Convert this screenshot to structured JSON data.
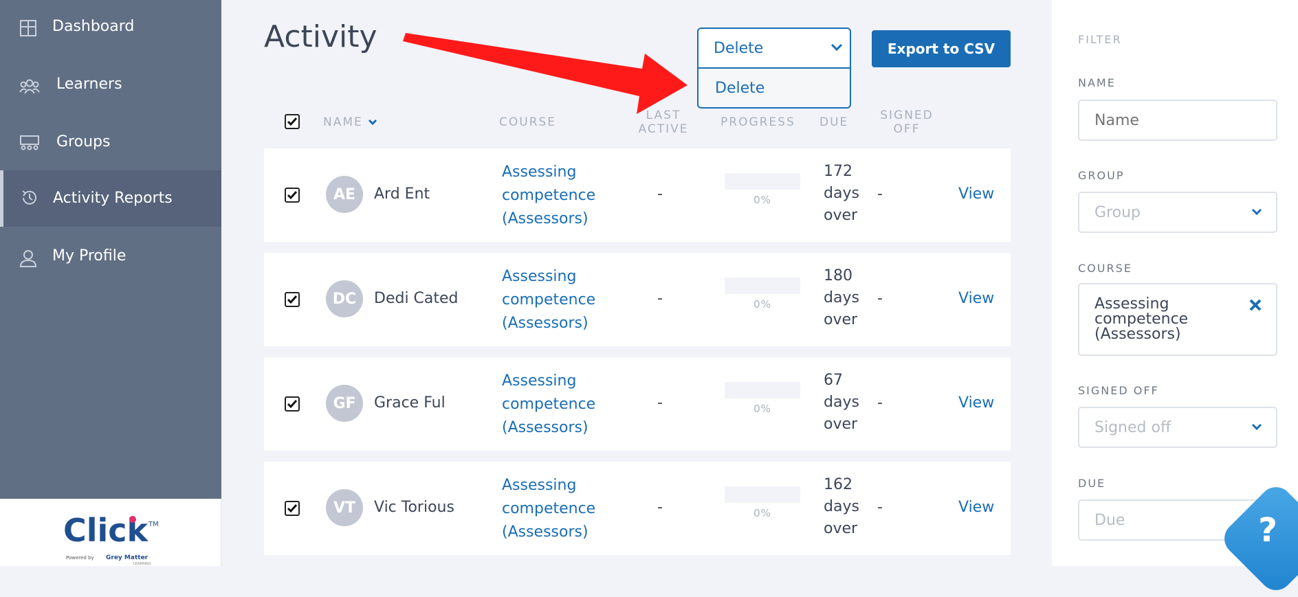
{
  "sidebar": {
    "items": [
      {
        "label": "Dashboard",
        "icon": "grid-icon"
      },
      {
        "label": "Learners",
        "icon": "people-icon"
      },
      {
        "label": "Groups",
        "icon": "group-icon"
      },
      {
        "label": "Activity Reports",
        "icon": "history-icon"
      },
      {
        "label": "My Profile",
        "icon": "user-icon"
      }
    ],
    "active_item": "Activity Reports",
    "logo": {
      "brand": "Click",
      "trademark": "TM",
      "tagline_prefix": "Powered by",
      "tagline_brand": "Grey Matter",
      "tagline_suffix": "LEARNING"
    }
  },
  "main": {
    "title": "Activity",
    "bulk_action": {
      "selected": "Delete",
      "options": [
        "Delete"
      ]
    },
    "export_label": "Export to CSV",
    "columns": {
      "name": "NAME",
      "course": "COURSE",
      "last_active_1": "LAST",
      "last_active_2": "ACTIVE",
      "progress": "PROGRESS",
      "due": "DUE",
      "signed_off_1": "SIGNED",
      "signed_off_2": "OFF"
    },
    "rows": [
      {
        "initials": "AE",
        "name": "Ard Ent",
        "course_line1": "Assessing",
        "course_line2": "competence",
        "course_line3": "(Assessors)",
        "last_active": "-",
        "progress": 0,
        "progress_label": "0%",
        "due": "172\ndays\nover",
        "signed_off": "-",
        "action": "View"
      },
      {
        "initials": "DC",
        "name": "Dedi Cated",
        "course_line1": "Assessing",
        "course_line2": "competence",
        "course_line3": "(Assessors)",
        "last_active": "-",
        "progress": 0,
        "progress_label": "0%",
        "due": "180\ndays\nover",
        "signed_off": "-",
        "action": "View"
      },
      {
        "initials": "GF",
        "name": "Grace Ful",
        "course_line1": "Assessing",
        "course_line2": "competence",
        "course_line3": "(Assessors)",
        "last_active": "-",
        "progress": 0,
        "progress_label": "0%",
        "due": "67\ndays\nover",
        "signed_off": "-",
        "action": "View"
      },
      {
        "initials": "VT",
        "name": "Vic Torious",
        "course_line1": "Assessing",
        "course_line2": "competence",
        "course_line3": "(Assessors)",
        "last_active": "-",
        "progress": 0,
        "progress_label": "0%",
        "due": "162\ndays\nover",
        "signed_off": "-",
        "action": "View"
      }
    ]
  },
  "filter": {
    "heading": "FILTER",
    "name_label": "NAME",
    "name_placeholder": "Name",
    "group_label": "GROUP",
    "group_placeholder": "Group",
    "course_label": "COURSE",
    "course_value": "Assessing competence (Assessors)",
    "signed_off_label": "SIGNED OFF",
    "signed_off_placeholder": "Signed off",
    "due_label": "DUE",
    "due_placeholder": "Due"
  },
  "help": {
    "glyph": "?"
  },
  "colors": {
    "accent": "#1a6db5",
    "sidebar": "#616f85",
    "annotation_arrow": "#ff1a1a"
  }
}
